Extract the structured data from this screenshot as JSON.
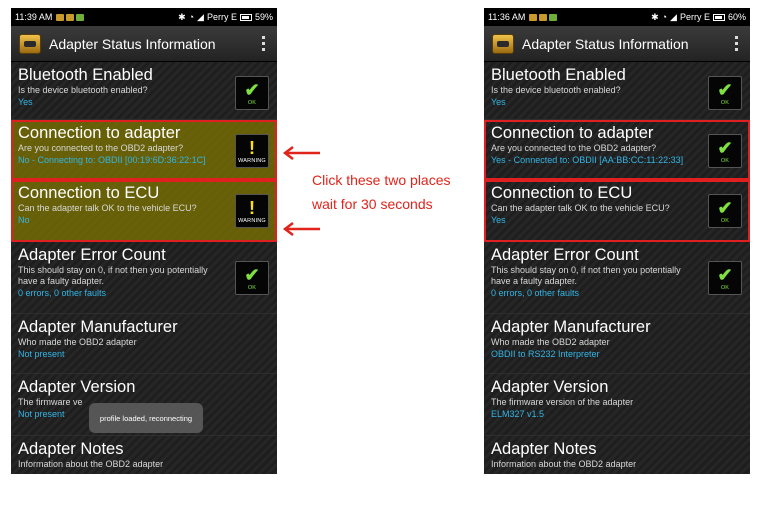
{
  "annotation": {
    "line1": "Click these two places",
    "line2": "wait for 30 seconds",
    "color": "#e0241b"
  },
  "left_screen": {
    "status": {
      "time": "11:39 AM",
      "carrier": "Perry E",
      "battery": "59%"
    },
    "app_title": "Adapter Status Information",
    "items": [
      {
        "title": "Bluetooth Enabled",
        "desc": "Is the device bluetooth enabled?",
        "value": "Yes",
        "badge": "OK",
        "badge_icon": "check-icon"
      },
      {
        "title": "Connection to adapter",
        "desc": "Are you connected to the OBD2 adapter?",
        "value": "No - Connecting to: OBDII [00:19:6D:36:22:1C]",
        "badge": "WARNING",
        "badge_icon": "exclamation-icon"
      },
      {
        "title": "Connection to ECU",
        "desc": "Can the adapter talk OK to the vehicle ECU?",
        "value": "No",
        "badge": "WARNING",
        "badge_icon": "exclamation-icon"
      },
      {
        "title": "Adapter Error Count",
        "desc": "This should stay on 0, if not then you potentially have a faulty adapter.",
        "value": "0 errors, 0 other faults",
        "badge": "OK",
        "badge_icon": "check-icon"
      },
      {
        "title": "Adapter Manufacturer",
        "desc": "Who made the OBD2 adapter",
        "value": "Not present"
      },
      {
        "title": "Adapter Version",
        "desc": "The firmware ve",
        "value": "Not present"
      },
      {
        "title": "Adapter Notes",
        "desc": "Information about the OBD2 adapter"
      }
    ],
    "toast": "profile loaded, reconnecting"
  },
  "right_screen": {
    "status": {
      "time": "11:36 AM",
      "carrier": "Perry E",
      "battery": "60%"
    },
    "app_title": "Adapter Status Information",
    "items": [
      {
        "title": "Bluetooth Enabled",
        "desc": "Is the device bluetooth enabled?",
        "value": "Yes",
        "badge": "OK",
        "badge_icon": "check-icon"
      },
      {
        "title": "Connection to adapter",
        "desc": "Are you connected to the OBD2 adapter?",
        "value": "Yes - Connected to: OBDII [AA:BB:CC:11:22:33]",
        "badge": "OK",
        "badge_icon": "check-icon"
      },
      {
        "title": "Connection to ECU",
        "desc": "Can the adapter talk OK to the vehicle ECU?",
        "value": "Yes",
        "badge": "OK",
        "badge_icon": "check-icon"
      },
      {
        "title": "Adapter Error Count",
        "desc": "This should stay on 0, if not then you potentially have a faulty adapter.",
        "value": "0 errors, 0 other faults",
        "badge": "OK",
        "badge_icon": "check-icon"
      },
      {
        "title": "Adapter Manufacturer",
        "desc": "Who made the OBD2 adapter",
        "value": "OBDII to RS232 Interpreter"
      },
      {
        "title": "Adapter Version",
        "desc": "The firmware version of the adapter",
        "value": "ELM327 v1.5"
      },
      {
        "title": "Adapter Notes",
        "desc": "Information about the OBD2 adapter"
      }
    ]
  },
  "colors": {
    "value_text": "#33b5e5",
    "ok": "#7fe040",
    "warning": "#ffe000",
    "highlight_border": "#e02020"
  }
}
